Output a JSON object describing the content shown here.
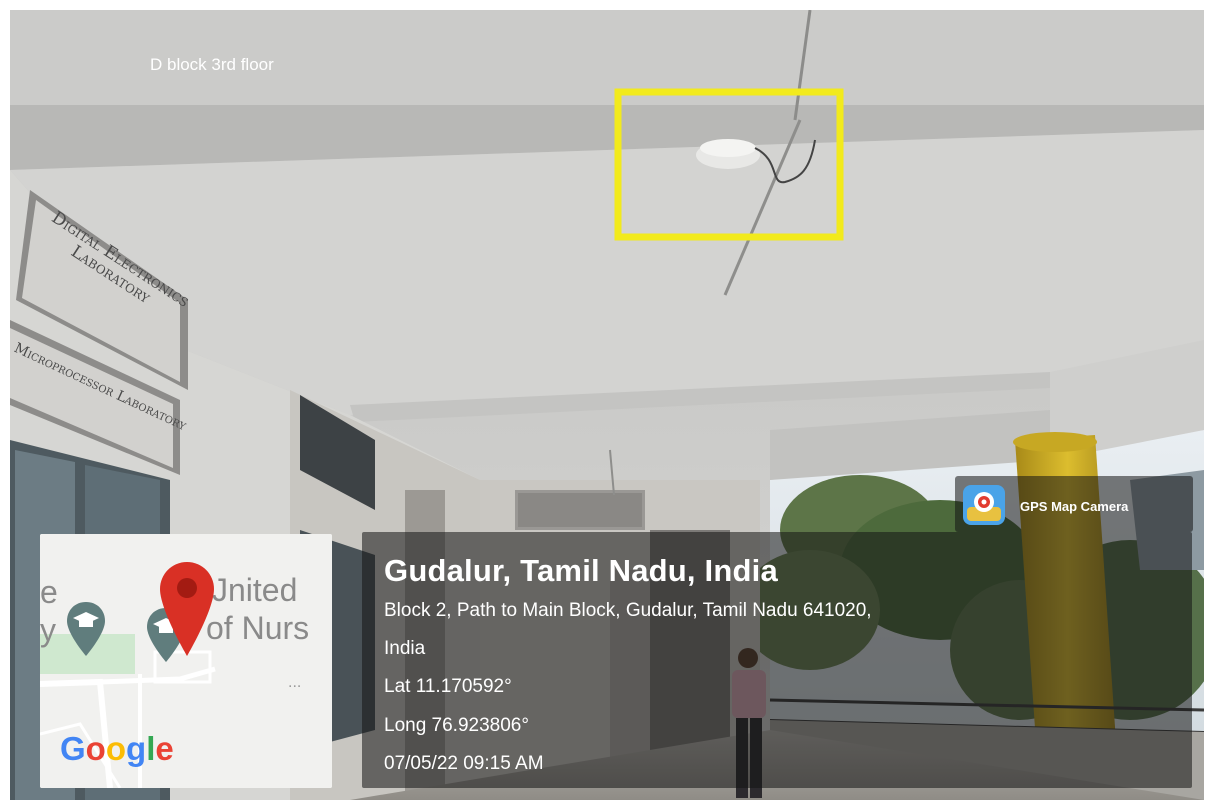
{
  "photo": {
    "caption": "D block 3rd floor",
    "signs": {
      "sign_1_line_1": "Digital Electronics",
      "sign_1_line_2": "Laboratory",
      "sign_2": "Microprocessor Laboratory"
    }
  },
  "map": {
    "label_line_1": "Jnited",
    "label_line_2": "of Nurs",
    "left_fragment_1": "e",
    "left_fragment_2": "y",
    "more": "...",
    "logo": "Google",
    "icons": [
      "graduation-cap-icon",
      "map-pin-icon"
    ]
  },
  "location": {
    "title": "Gudalur, Tamil Nadu, India",
    "address_line_1": "Block 2, Path to Main Block, Gudalur, Tamil Nadu 641020,",
    "address_line_2": "India",
    "lat": "Lat 11.170592°",
    "long": "Long 76.923806°",
    "datetime": "07/05/22 09:15 AM"
  },
  "app": {
    "name": "GPS Map Camera"
  },
  "colors": {
    "highlight_box": "#f2ea1c",
    "pin": "#d93025",
    "pillar": "#d9b92a"
  }
}
